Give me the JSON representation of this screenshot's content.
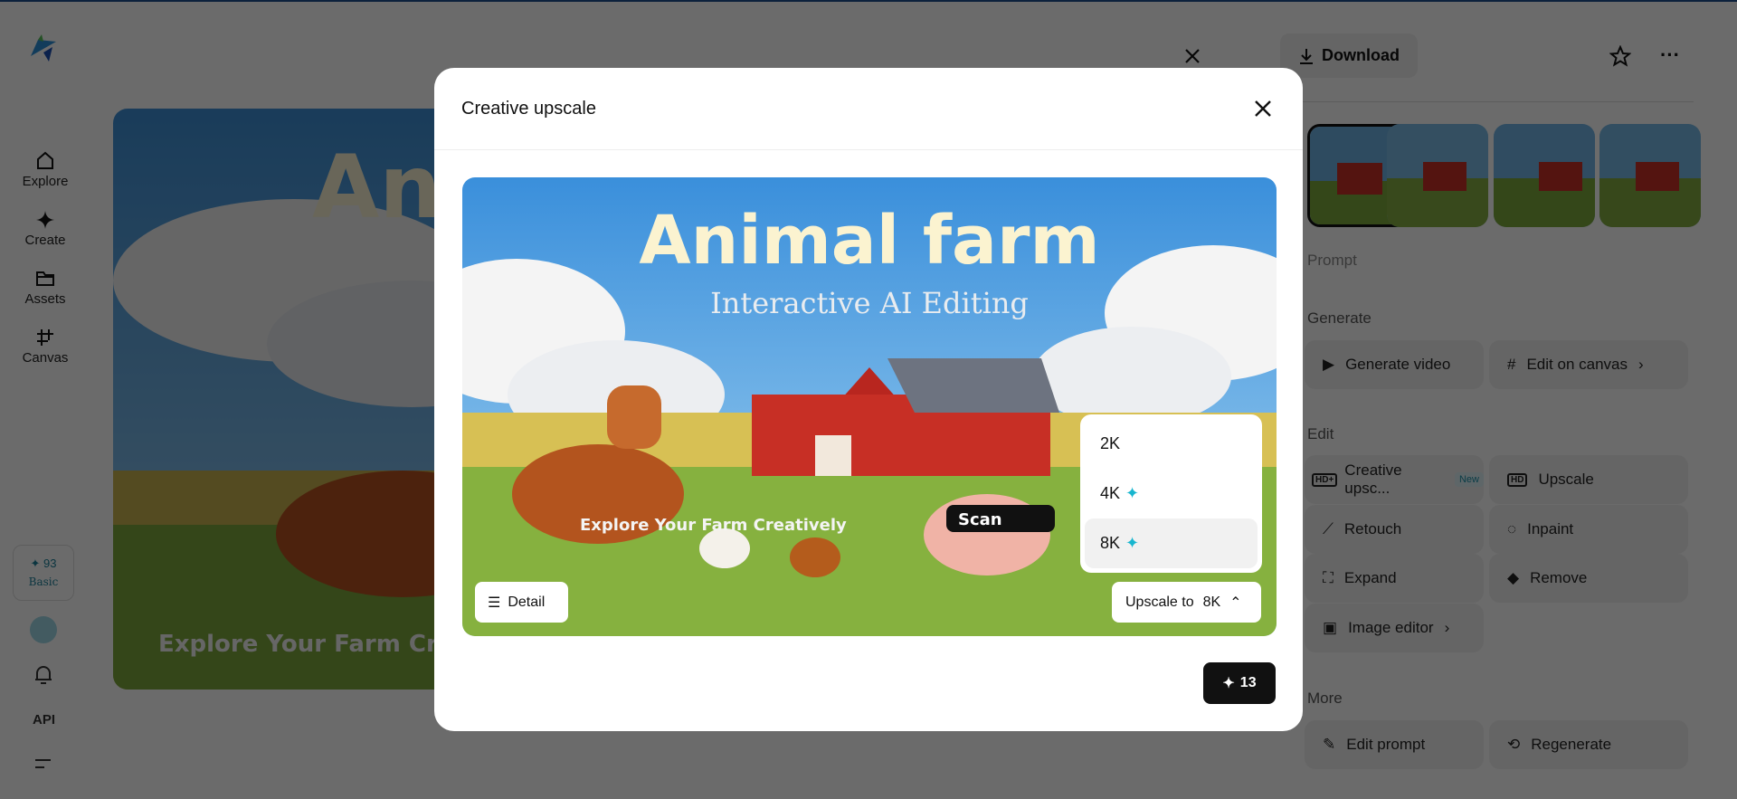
{
  "sidebar": {
    "items": [
      {
        "label": "Explore"
      },
      {
        "label": "Create"
      },
      {
        "label": "Assets"
      },
      {
        "label": "Canvas"
      }
    ],
    "credits": "93",
    "plan": "Basic",
    "api": "API"
  },
  "image": {
    "title": "Animal farm",
    "subtitle": "Interactive AI Editing",
    "footer": "Explore Your Farm Creatively",
    "scan": "Scan"
  },
  "header": {
    "download": "Download"
  },
  "sections": {
    "prompt": "Prompt",
    "generate": "Generate",
    "edit": "Edit",
    "more": "More"
  },
  "generate": [
    {
      "label": "Generate video"
    },
    {
      "label": "Edit on canvas"
    }
  ],
  "edit": [
    {
      "label": "Creative upsc...",
      "badge": "New"
    },
    {
      "label": "Upscale"
    },
    {
      "label": "Retouch"
    },
    {
      "label": "Inpaint"
    },
    {
      "label": "Expand"
    },
    {
      "label": "Remove"
    },
    {
      "label": "Image editor"
    }
  ],
  "more": [
    {
      "label": "Edit prompt"
    },
    {
      "label": "Regenerate"
    }
  ],
  "modal": {
    "title": "Creative upscale",
    "detail": "Detail",
    "upscale_label": "Upscale to",
    "upscale_value": "8K",
    "options": [
      {
        "label": "2K"
      },
      {
        "label": "4K"
      },
      {
        "label": "8K"
      }
    ],
    "cost": "13"
  },
  "colors": {
    "accent": "#18b6cf",
    "dark": "#111111"
  }
}
